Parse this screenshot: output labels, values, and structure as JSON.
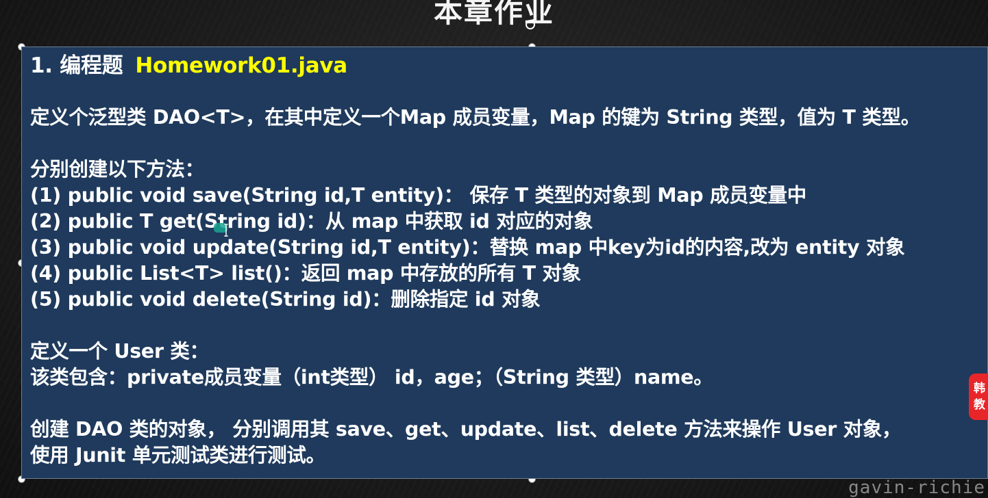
{
  "slide": {
    "title": "本章作业"
  },
  "textbox": {
    "heading_number": "1. 编程题",
    "heading_file": "Homework01.java",
    "lines": [
      "定义个泛型类 DAO<T>，在其中定义一个Map 成员变量，Map 的键为 String 类型，值为 T 类型。",
      "分别创建以下方法：",
      "(1) public void save(String id,T entity)： 保存 T 类型的对象到 Map 成员变量中",
      "(2) public T get(String id)：从 map 中获取 id 对应的对象",
      "(3) public void update(String id,T entity)：替换 map 中key为id的内容,改为 entity 对象",
      "(4) public List<T> list()：返回 map 中存放的所有 T 对象",
      "(5) public void delete(String id)：删除指定 id 对象",
      "定义一个 User 类：",
      "该类包含：private成员变量（int类型） id，age；（String 类型）name。",
      "创建 DAO 类的对象， 分别调用其 save、get、update、list、delete 方法来操作 User 对象，",
      "使用 Junit 单元测试类进行测试。"
    ]
  },
  "badge": {
    "text_top": "韩",
    "text_bottom": "教",
    "color": "#e8262a"
  },
  "watermark": "gavin-richie",
  "colors": {
    "textbox_bg": "#1f3a5c",
    "heading_file": "#ffff00"
  }
}
